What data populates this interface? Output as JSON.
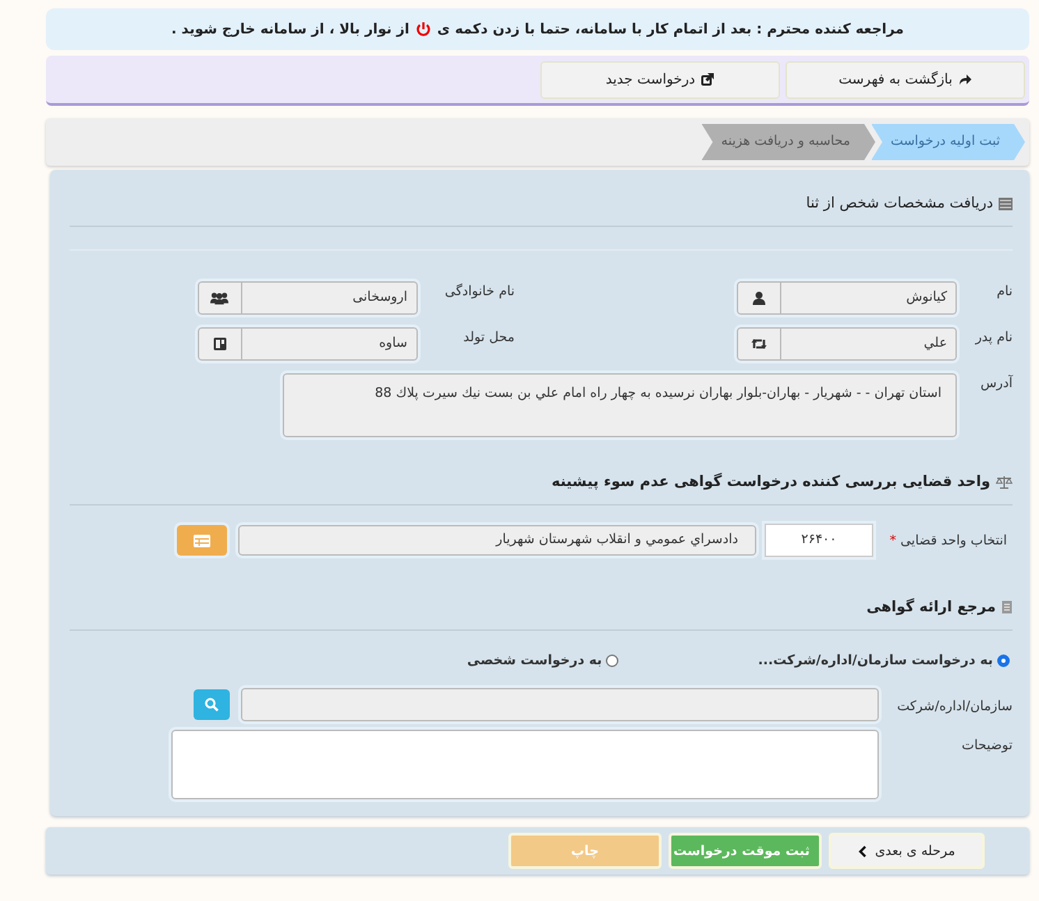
{
  "notice": {
    "text_before": "مراجعه کننده محترم : بعد از اتمام کار با سامانه، حتما با زدن دکمه ی",
    "text_after": "از نوار بالا ، از سامانه خارج شوید ."
  },
  "toolbar": {
    "buttons": [
      {
        "label": "بازگشت به فهرست",
        "kind": "share"
      },
      {
        "label": "درخواست جدید",
        "kind": "external"
      }
    ]
  },
  "wizard": {
    "steps": [
      {
        "label": "ثبت اولیه درخواست",
        "selected": true
      },
      {
        "label": "محاسبه و دریافت هزینه",
        "selected": false
      }
    ]
  },
  "person_section": {
    "title": "دریافت مشخصات شخص از ثنا",
    "fields": [
      {
        "label": "نام",
        "value": "کیانوش",
        "kind": "user"
      },
      {
        "label": "نام خانوادگی",
        "value": "اروسخانی",
        "kind": "users"
      },
      {
        "label": "نام پدر",
        "value": "علي",
        "kind": "retweet"
      },
      {
        "label": "محل تولد",
        "value": "ساوه",
        "kind": "map"
      }
    ],
    "address": {
      "label": "آدرس",
      "value": "استان تهران -  - شهريار - بهاران-بلوار بهاران نرسيده به چهار راه امام علي بن بست نيك سيرت پلاك 88"
    }
  },
  "judicial_section": {
    "title": "واحد قضایی بررسی کننده درخواست گواهی عدم سوء پیشینه",
    "label": "انتخاب واحد قضایی",
    "required_mark": "*",
    "code": "۲۶۴۰۰",
    "unit_name": "دادسراي عمومي و انقلاب شهرستان شهريار"
  },
  "certificate_section": {
    "title": "مرجع ارائه گواهی",
    "options": [
      {
        "label": "به درخواست سازمان/اداره/شرکت...",
        "selected": true
      },
      {
        "label": "به درخواست شخصی",
        "selected": false
      }
    ],
    "organization": {
      "label": "سازمان/اداره/شرکت"
    },
    "description": {
      "label": "توضیحات"
    }
  },
  "footer": {
    "buttons": [
      {
        "label": "مرحله ی بعدی",
        "kind": "next"
      },
      {
        "label": "ثبت موقت درخواست",
        "kind": "save"
      },
      {
        "label": "چاپ",
        "kind": "print"
      }
    ]
  }
}
